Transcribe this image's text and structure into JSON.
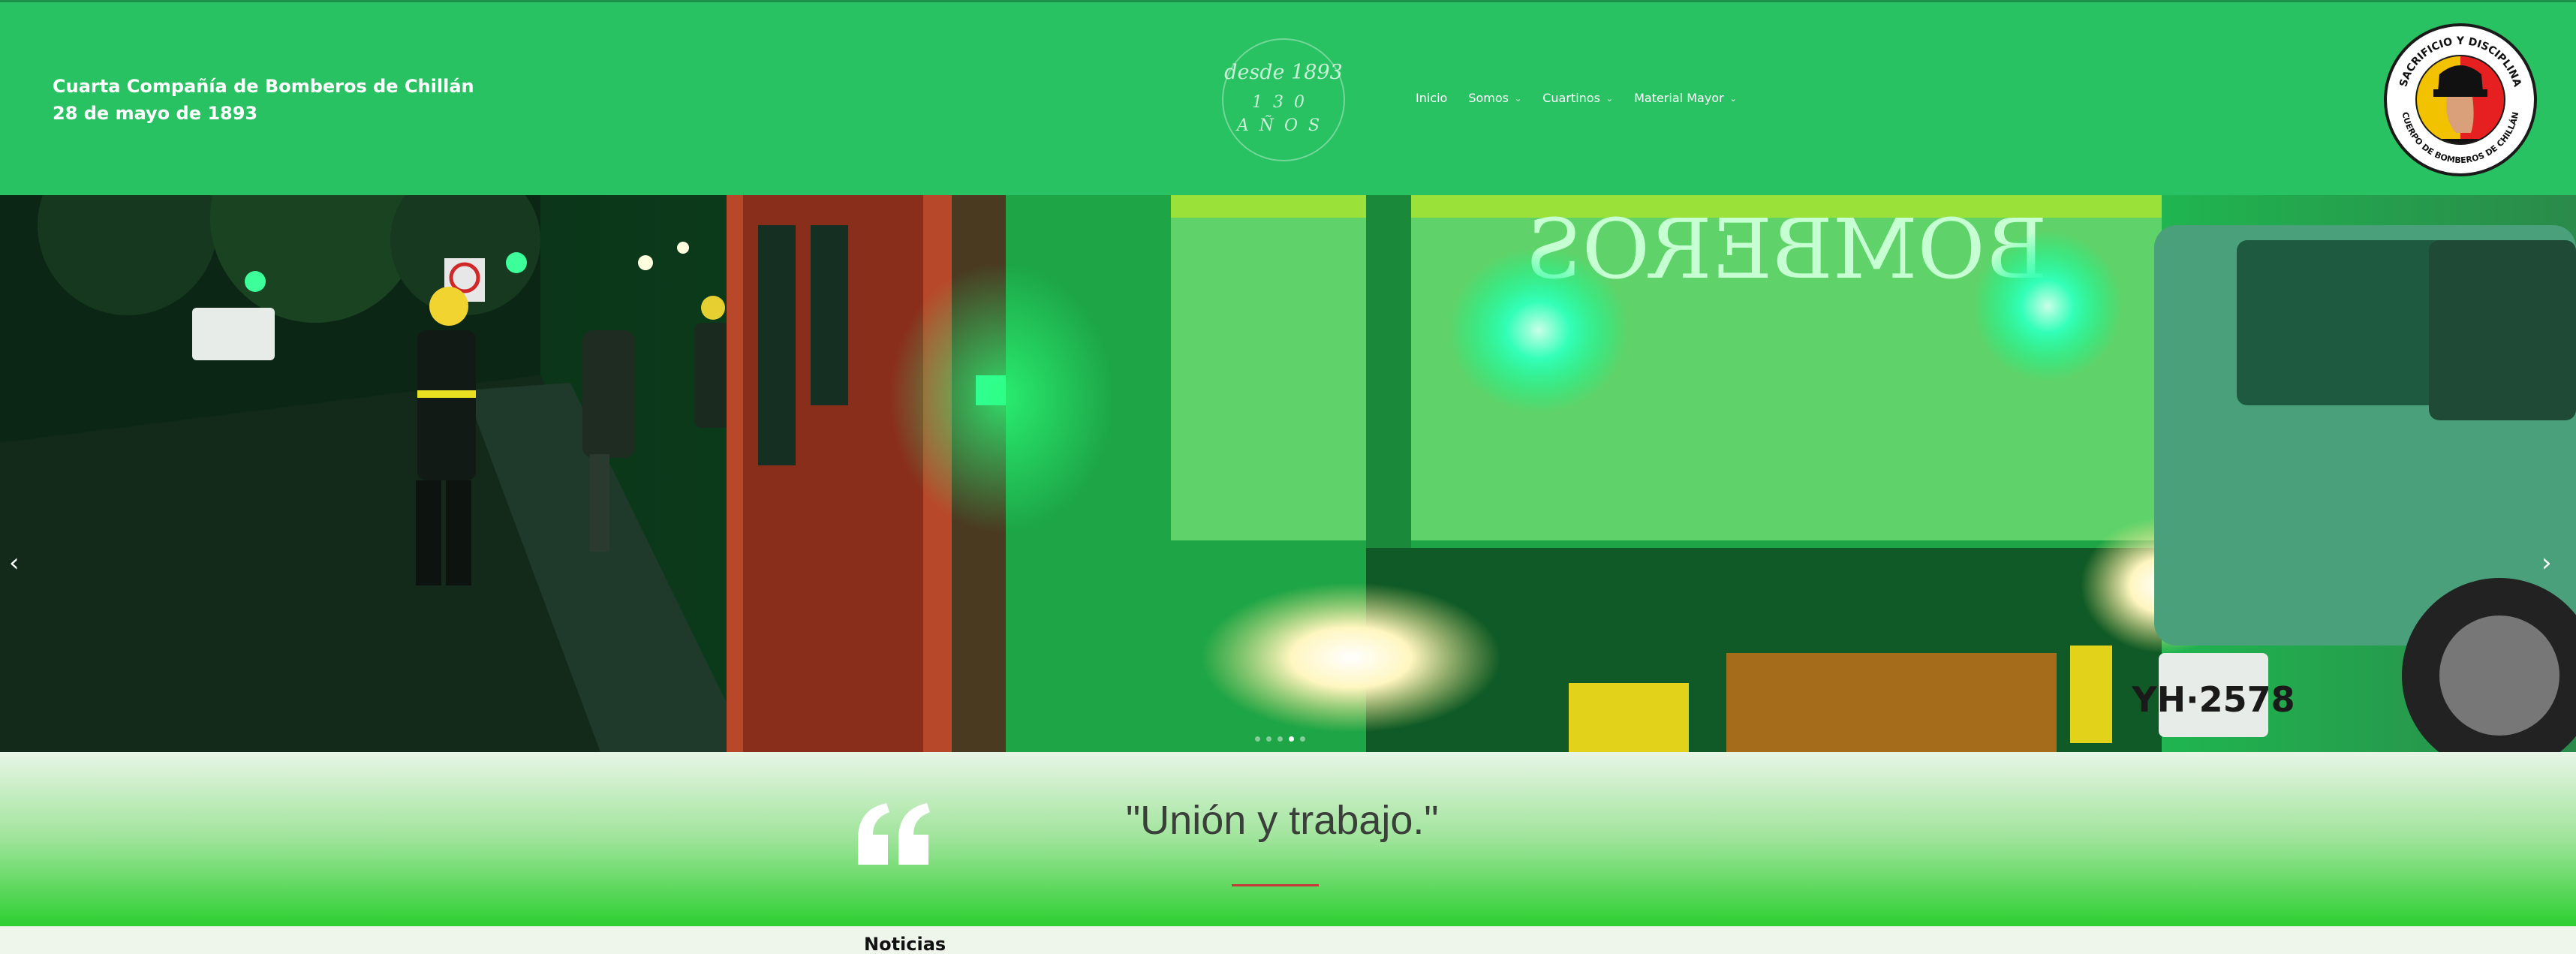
{
  "header": {
    "brand_line1": "Cuarta Compañía de Bomberos de Chillán",
    "brand_line2": "28 de mayo de 1893",
    "badge_since": "desde 1893",
    "badge_years": "130",
    "badge_word": "AÑOS",
    "nav": [
      {
        "label": "Inicio",
        "has_dropdown": false
      },
      {
        "label": "Somos",
        "has_dropdown": true
      },
      {
        "label": "Cuartinos",
        "has_dropdown": true
      },
      {
        "label": "Material Mayor",
        "has_dropdown": true
      }
    ],
    "seal_top": "SACRIFICIO Y DISCIPLINA",
    "seal_bottom": "CUERPO DE BOMBEROS DE CHILLÁN",
    "accent_color": "#28c262"
  },
  "hero": {
    "truck_text": "BOMBEROS",
    "plate_text": "YH·2578",
    "prev_icon": "chevron-left-icon",
    "next_icon": "chevron-right-icon",
    "slide_count": 5,
    "active_slide": 4
  },
  "quote": {
    "text": "\"Unión y trabajo.\"",
    "icon": "quote-icon",
    "line_color": "#c73838"
  },
  "section": {
    "heading": "Noticias"
  }
}
